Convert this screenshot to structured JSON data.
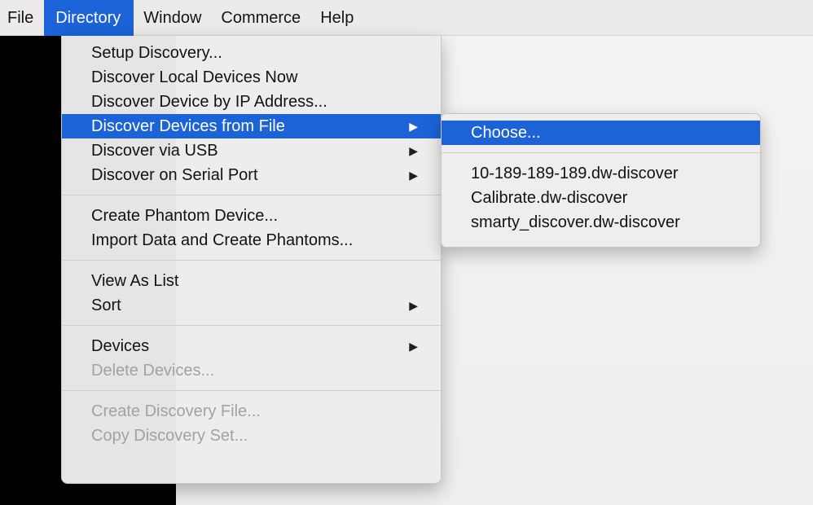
{
  "menubar": {
    "items": [
      {
        "label": "File"
      },
      {
        "label": "Directory"
      },
      {
        "label": "Window"
      },
      {
        "label": "Commerce"
      },
      {
        "label": "Help"
      }
    ]
  },
  "directory_menu": {
    "setup_discovery": "Setup Discovery...",
    "discover_local": "Discover Local Devices Now",
    "discover_ip": "Discover Device by IP Address...",
    "discover_file": "Discover Devices from File",
    "discover_usb": "Discover via USB",
    "discover_serial": "Discover on Serial Port",
    "create_phantom": "Create Phantom Device...",
    "import_data": "Import Data and Create Phantoms...",
    "view_as_list": "View As List",
    "sort": "Sort",
    "devices": "Devices",
    "delete_devices": "Delete Devices...",
    "create_discovery_file": "Create Discovery File...",
    "copy_discovery_set": "Copy Discovery Set...",
    "arrow_glyph": "▶"
  },
  "submenu": {
    "choose": "Choose...",
    "files": [
      "10-189-189-189.dw-discover",
      "Calibrate.dw-discover",
      "smarty_discover.dw-discover"
    ]
  },
  "colors": {
    "highlight": "#1b63d6",
    "disabled_text": "#a2a2a2"
  }
}
